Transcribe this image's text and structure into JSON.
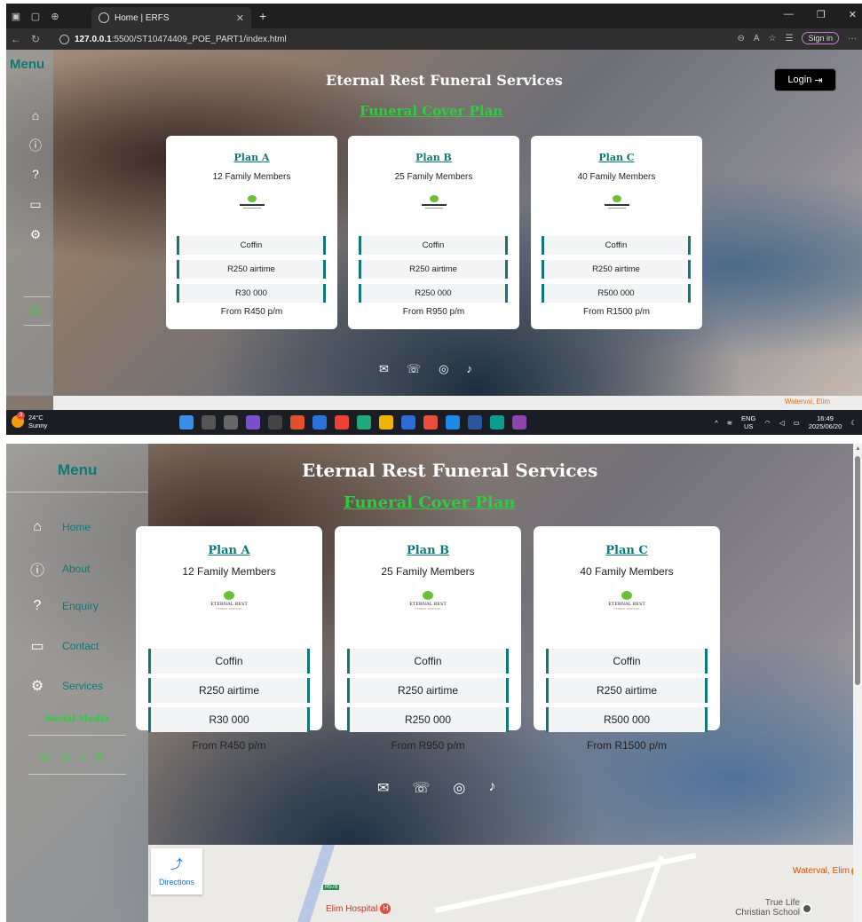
{
  "top": {
    "tab_title": "Home | ERFS",
    "url_host": "127.0.0.1",
    "url_rest": ":5500/ST10474409_POE_PART1/index.html",
    "sign_in": "Sign in",
    "login_label": "Login",
    "weather_temp": "24°C",
    "weather_desc": "Sunny",
    "weather_badge": "3",
    "lang_top": "ENG",
    "lang_bottom": "US",
    "clock_time": "16:49",
    "clock_date": "2025/06/20",
    "map_place": "Waterval, Elim"
  },
  "site": {
    "title": "Eternal Rest Funeral Services",
    "subtitle": "Funeral Cover Plan",
    "menu_title": "Menu",
    "menu_items": [
      {
        "label": "Home",
        "icon": "home-icon"
      },
      {
        "label": "About",
        "icon": "info-icon"
      },
      {
        "label": "Enquiry",
        "icon": "question-icon"
      },
      {
        "label": "Contact",
        "icon": "contact-card-icon"
      },
      {
        "label": "Services",
        "icon": "gears-icon"
      }
    ],
    "social_title": "Social Media",
    "logo_text": "ETERNAL REST",
    "logo_subtext": "FUNERAL SERVICES",
    "plans": [
      {
        "name": "Plan A",
        "members": "12 Family Members",
        "features": [
          "Coffin",
          "R250 airtime",
          "R30 000"
        ],
        "price": "From R450 p/m"
      },
      {
        "name": "Plan B",
        "members": "25 Family Members",
        "features": [
          "Coffin",
          "R250 airtime",
          "R250 000"
        ],
        "price": "From R950 p/m"
      },
      {
        "name": "Plan C",
        "members": "40 Family Members",
        "features": [
          "Coffin",
          "R250 airtime",
          "R500 000"
        ],
        "price": "From R1500 p/m"
      }
    ],
    "social_icons": [
      "mail-icon",
      "whatsapp-icon",
      "instagram-icon",
      "tiktok-icon"
    ]
  },
  "map": {
    "directions_label": "Directions",
    "road_label": "R578",
    "hospital": "Elim Hospital",
    "place": "Waterval, Elim",
    "school_line1": "True Life",
    "school_line2": "Christian School"
  },
  "colors": {
    "accent": "#0d7a78",
    "green": "#2ecc40",
    "whatsapp": "#3ed13e"
  }
}
